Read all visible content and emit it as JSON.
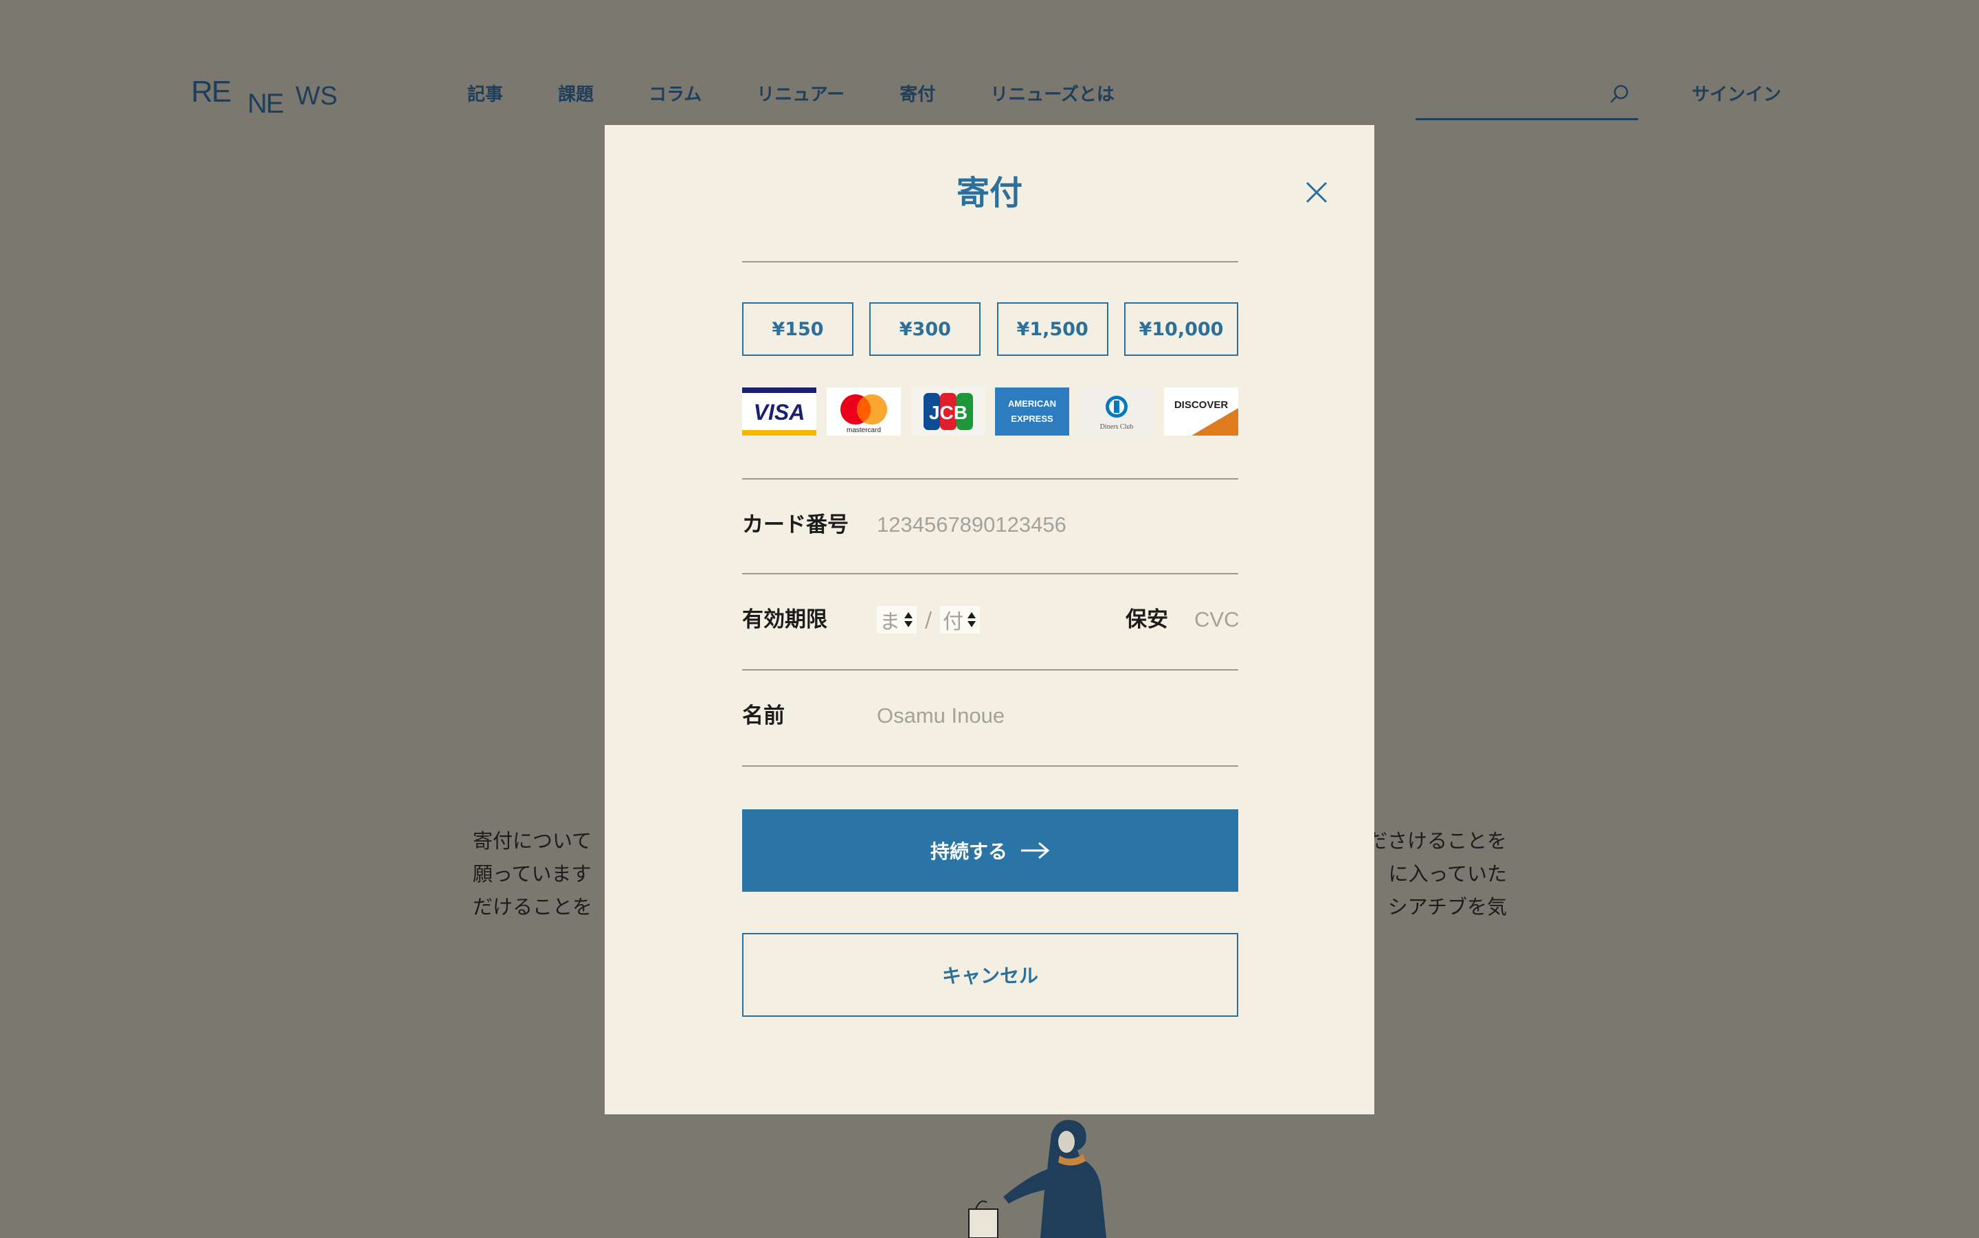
{
  "header": {
    "logo": "RENEWS",
    "nav": [
      "記事",
      "課題",
      "コラム",
      "リニュアー",
      "寄付",
      "リニューズとは"
    ],
    "search": {
      "placeholder": ""
    },
    "signin": "サインイン"
  },
  "background": {
    "left_lines": [
      "寄付について",
      "願っています",
      "だけることを"
    ],
    "right_lines": [
      "ださけることを",
      "に入っていた",
      "シアチブを気"
    ]
  },
  "modal": {
    "title": "寄付",
    "amounts": [
      "¥150",
      "¥300",
      "¥1,500",
      "¥10,000"
    ],
    "card_brands": [
      "VISA",
      "mastercard",
      "JCB",
      "AMERICAN EXPRESS",
      "Diners Club",
      "DISCOVER"
    ],
    "card_number": {
      "label": "カード番号",
      "placeholder": "1234567890123456"
    },
    "expiry": {
      "label": "有効期限",
      "month": "ま",
      "year": "付",
      "separator": "/"
    },
    "cvc": {
      "label": "保安",
      "placeholder": "CVC"
    },
    "name": {
      "label": "名前",
      "placeholder": "Osamu Inoue"
    },
    "continue_label": "持続する",
    "cancel_label": "キャンセル"
  },
  "colors": {
    "overlay": "#7b7870",
    "modal_bg": "#f3f0e3",
    "accent": "#2b6f9a",
    "button": "#2b75a6",
    "navy": "#1e3e5c"
  }
}
